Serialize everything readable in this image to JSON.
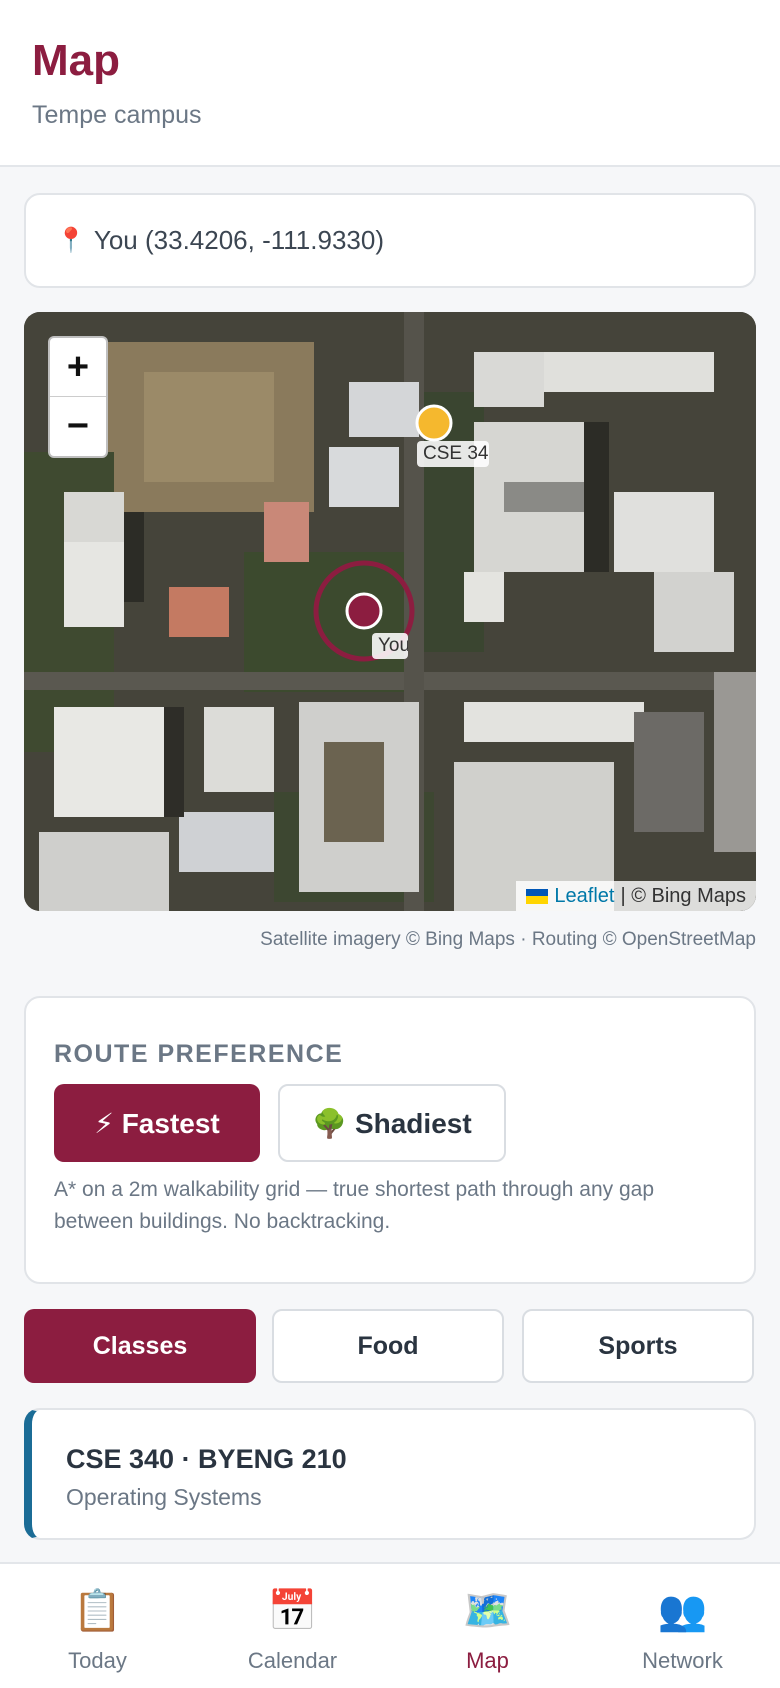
{
  "header": {
    "title": "Map",
    "subtitle": "Tempe campus"
  },
  "location": {
    "icon": "📍",
    "text": "You (33.4206, -111.9330)"
  },
  "map": {
    "zoom_in": "+",
    "zoom_out": "−",
    "markers": [
      {
        "label": "CSE 340",
        "color": "#f5b82e"
      },
      {
        "label": "You",
        "color": "#8c1d40"
      }
    ],
    "attribution_link": "Leaflet",
    "attribution_rest": "| © Bing Maps"
  },
  "credit": "Satellite imagery © Bing Maps · Routing © OpenStreetMap",
  "route": {
    "heading": "ROUTE PREFERENCE",
    "options": [
      {
        "label": "⚡ Fastest",
        "active": true
      },
      {
        "label": "🌳 Shadiest",
        "active": false
      }
    ],
    "description": "A* on a 2m walkability grid — true shortest path through any gap between buildings. No backtracking."
  },
  "categories": [
    {
      "label": "Classes",
      "active": true
    },
    {
      "label": "Food",
      "active": false
    },
    {
      "label": "Sports",
      "active": false
    }
  ],
  "class_item": {
    "title": "CSE 340 · BYENG 210",
    "subtitle": "Operating Systems"
  },
  "tabs": [
    {
      "icon": "📋",
      "label": "Today"
    },
    {
      "icon": "📅",
      "label": "Calendar"
    },
    {
      "icon": "🗺️",
      "label": "Map",
      "active": true
    },
    {
      "icon": "👥",
      "label": "Network"
    }
  ],
  "colors": {
    "brand": "#8c1d40",
    "accent": "#1b6c96",
    "destination_marker": "#f5b82e"
  }
}
